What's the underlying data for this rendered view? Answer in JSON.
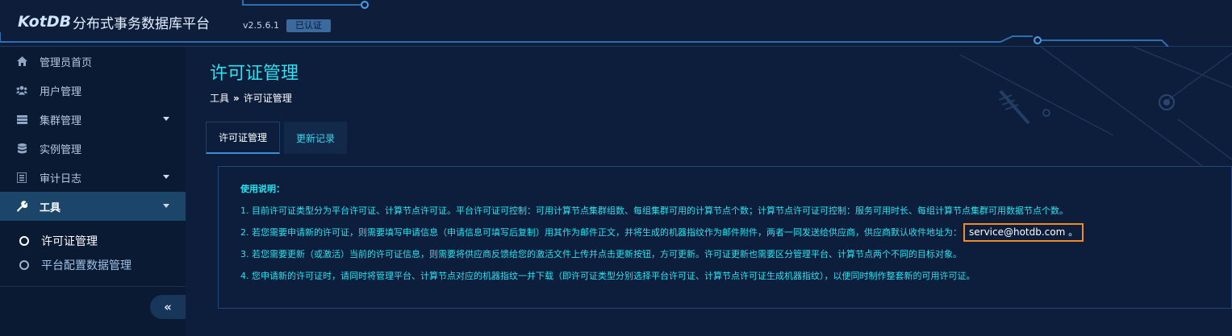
{
  "header": {
    "logo_text": "KotDB",
    "app_title": "分布式事务数据库平台",
    "version": "v2.5.6.1",
    "cert_badge": "已认证"
  },
  "sidebar": {
    "items": [
      {
        "label": "管理员首页",
        "icon": "home-icon"
      },
      {
        "label": "用户管理",
        "icon": "users-icon"
      },
      {
        "label": "集群管理",
        "icon": "server-icon",
        "has_caret": true
      },
      {
        "label": "实例管理",
        "icon": "database-icon"
      },
      {
        "label": "审计日志",
        "icon": "list-icon",
        "has_caret": true
      },
      {
        "label": "工具",
        "icon": "wrench-icon",
        "has_caret": true,
        "active": true
      }
    ],
    "sub_items": [
      {
        "label": "许可证管理",
        "active": true
      },
      {
        "label": "平台配置数据管理"
      }
    ],
    "collapse_label": "«"
  },
  "main": {
    "title": "许可证管理",
    "breadcrumb": {
      "root": "工具",
      "sep": "»",
      "current": "许可证管理"
    },
    "tabs": [
      {
        "label": "许可证管理",
        "active": true
      },
      {
        "label": "更新记录"
      }
    ],
    "notice": {
      "title": "使用说明：",
      "lines": [
        "1. 目前许可证类型分为平台许可证、计算节点许可证。平台许可证可控制：可用计算节点集群组数、每组集群可用的计算节点个数；计算节点许可证可控制：服务可用时长、每组计算节点集群可用数据节点个数。",
        "2. 若您需要申请新的许可证，则需要填写申请信息（申请信息可填写后复制）用其作为邮件正文，并将生成的机器指纹作为邮件附件，两者一同发送给供应商，供应商默认收件地址为：",
        "3. 若您需要更新（或激活）当前的许可证信息，则需要将供应商反馈给您的激活文件上传并点击更新按钮，方可更新。许可证更新也需要区分管理平台、计算节点两个不同的目标对象。",
        "4. 您申请新的许可证时，请同时将管理平台、计算节点对应的机器指纹一并下载（即许可证类型分别选择平台许可证、计算节点许可证生成机器指纹），以便同时制作整套新的可用许可证。"
      ],
      "email": "service@hotdb.com 。"
    }
  },
  "colors": {
    "accent_cyan": "#2ee2f0",
    "highlight_orange": "#f08a24",
    "sidebar_active": "#1b4569"
  }
}
